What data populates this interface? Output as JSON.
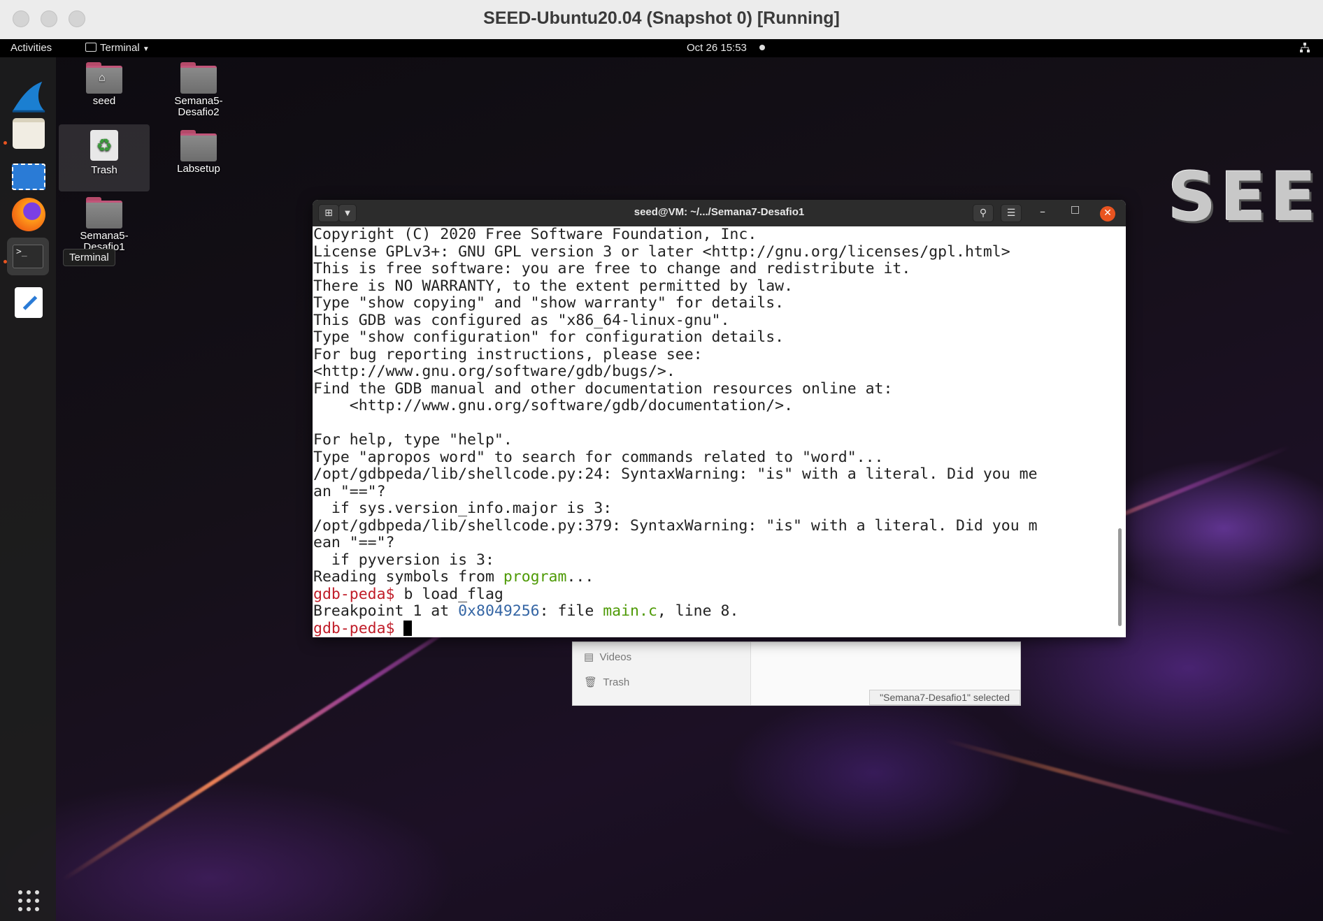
{
  "mac": {
    "title": "SEED-Ubuntu20.04 (Snapshot 0) [Running]"
  },
  "topbar": {
    "activities": "Activities",
    "app_menu": "Terminal",
    "clock": "Oct 26  15:53"
  },
  "desktop": {
    "icons": [
      {
        "label": "seed"
      },
      {
        "label": "Semana5-\nDesafio2"
      },
      {
        "label": "Trash"
      },
      {
        "label": "Labsetup"
      },
      {
        "label": "Semana5-\nDesafio1"
      }
    ],
    "dock_tooltip": "Terminal",
    "logo_text": "SEED"
  },
  "files_window": {
    "sidebar": [
      "Videos",
      "Trash"
    ],
    "status": "\"Semana7-Desafio1\" selected"
  },
  "terminal": {
    "title": "seed@VM: ~/.../Semana7-Desafio1",
    "lines": [
      "Copyright (C) 2020 Free Software Foundation, Inc.",
      "License GPLv3+: GNU GPL version 3 or later <http://gnu.org/licenses/gpl.html>",
      "This is free software: you are free to change and redistribute it.",
      "There is NO WARRANTY, to the extent permitted by law.",
      "Type \"show copying\" and \"show warranty\" for details.",
      "This GDB was configured as \"x86_64-linux-gnu\".",
      "Type \"show configuration\" for configuration details.",
      "For bug reporting instructions, please see:",
      "<http://www.gnu.org/software/gdb/bugs/>.",
      "Find the GDB manual and other documentation resources online at:",
      "    <http://www.gnu.org/software/gdb/documentation/>.",
      "",
      "For help, type \"help\".",
      "Type \"apropos word\" to search for commands related to \"word\"...",
      "/opt/gdbpeda/lib/shellcode.py:24: SyntaxWarning: \"is\" with a literal. Did you me",
      "an \"==\"?",
      "  if sys.version_info.major is 3:",
      "/opt/gdbpeda/lib/shellcode.py:379: SyntaxWarning: \"is\" with a literal. Did you m",
      "ean \"==\"?",
      "  if pyversion is 3:"
    ],
    "reading_prefix": "Reading symbols from ",
    "reading_file": "program",
    "reading_suffix": "...",
    "prompt": "gdb-peda$",
    "command": " b load_flag",
    "bp_prefix": "Breakpoint 1 at ",
    "bp_addr": "0x8049256",
    "bp_mid": ": file ",
    "bp_file": "main.c",
    "bp_suffix": ", line 8."
  },
  "colors": {
    "prompt": "#c01c28",
    "filename": "#4e9a06",
    "address": "#3465a4",
    "close_button": "#e95420"
  }
}
